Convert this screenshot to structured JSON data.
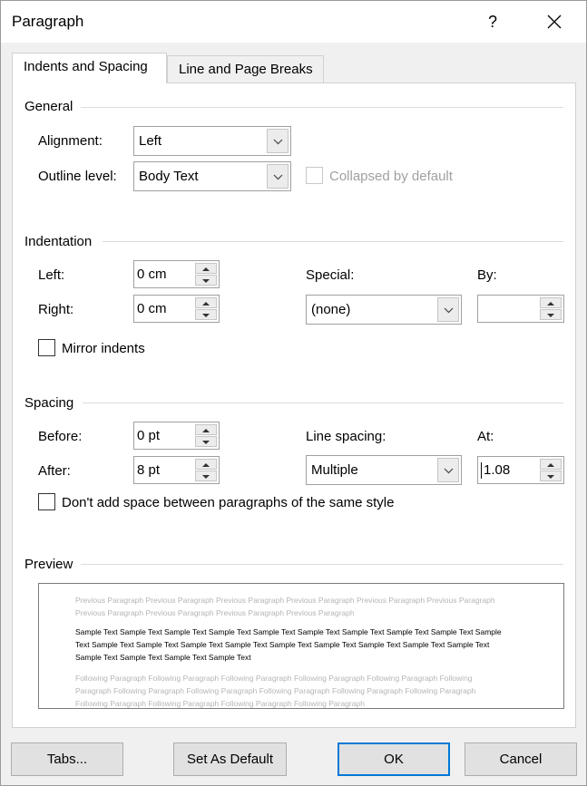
{
  "dialog": {
    "title": "Paragraph",
    "help": "?",
    "close_icon": "close-icon"
  },
  "tabs": [
    {
      "label": "Indents and Spacing",
      "active": true
    },
    {
      "label": "Line and Page Breaks",
      "active": false
    }
  ],
  "general": {
    "title": "General",
    "alignment_label": "Alignment:",
    "alignment_value": "Left",
    "outline_label": "Outline level:",
    "outline_value": "Body Text",
    "collapsed_label": "Collapsed by default",
    "collapsed_checked": false
  },
  "indentation": {
    "title": "Indentation",
    "left_label": "Left:",
    "left_value": "0 cm",
    "right_label": "Right:",
    "right_value": "0 cm",
    "special_label": "Special:",
    "special_value": "(none)",
    "by_label": "By:",
    "by_value": "",
    "mirror_label": "Mirror indents",
    "mirror_checked": false
  },
  "spacing": {
    "title": "Spacing",
    "before_label": "Before:",
    "before_value": "0 pt",
    "after_label": "After:",
    "after_value": "8 pt",
    "line_spacing_label": "Line spacing:",
    "line_spacing_value": "Multiple",
    "at_label": "At:",
    "at_value": "1.08",
    "dont_add_label": "Don't add space between paragraphs of the same style",
    "dont_add_checked": false
  },
  "preview": {
    "title": "Preview",
    "previous_text": "Previous Paragraph Previous Paragraph Previous Paragraph Previous Paragraph Previous Paragraph Previous Paragraph Previous Paragraph Previous Paragraph Previous Paragraph Previous Paragraph",
    "sample_text": "Sample Text Sample Text Sample Text Sample Text Sample Text Sample Text Sample Text Sample Text Sample Text Sample Text Sample Text Sample Text Sample Text Sample Text Sample Text Sample Text Sample Text Sample Text Sample Text Sample Text Sample Text Sample Text Sample Text",
    "following_text": "Following Paragraph Following Paragraph Following Paragraph Following Paragraph Following Paragraph Following Paragraph Following Paragraph Following Paragraph Following Paragraph Following Paragraph Following Paragraph Following Paragraph Following Paragraph Following Paragraph Following Paragraph"
  },
  "buttons": {
    "tabs": "Tabs...",
    "set_default": "Set As Default",
    "ok": "OK",
    "cancel": "Cancel"
  }
}
